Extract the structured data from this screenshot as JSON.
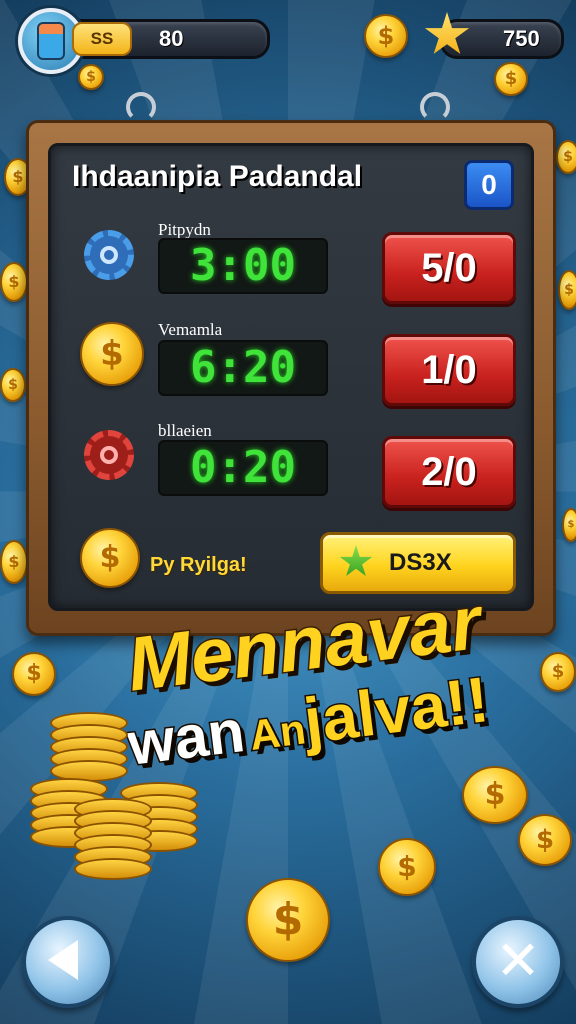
{
  "hud": {
    "left_badge": "SS",
    "coins_value": "80",
    "stars_value": "750"
  },
  "board": {
    "title": "Ihdaanipia Padandal",
    "count_badge": "0",
    "rows": [
      {
        "label": "Pitpydn",
        "timer": "3:00",
        "button": "5/0",
        "icon": "blue-gear-icon"
      },
      {
        "label": "Vemamla",
        "timer": "6:20",
        "button": "1/0",
        "icon": "gold-coin-pedestal-icon"
      },
      {
        "label": "bllaeien",
        "timer": "0:20",
        "button": "2/0",
        "icon": "red-gear-icon"
      }
    ],
    "promo_text": "Py Ryilga!",
    "action_button": "DS3X"
  },
  "headline": {
    "line1": "Mennavar",
    "line2_part1": "wan",
    "line2_part2": "An",
    "line2_part3": "jalva!!"
  },
  "colors": {
    "background": "#2a6f9f",
    "timer_green": "#3fe33a",
    "button_red": "#c8211e",
    "headline_yellow": "#ffd21f"
  }
}
